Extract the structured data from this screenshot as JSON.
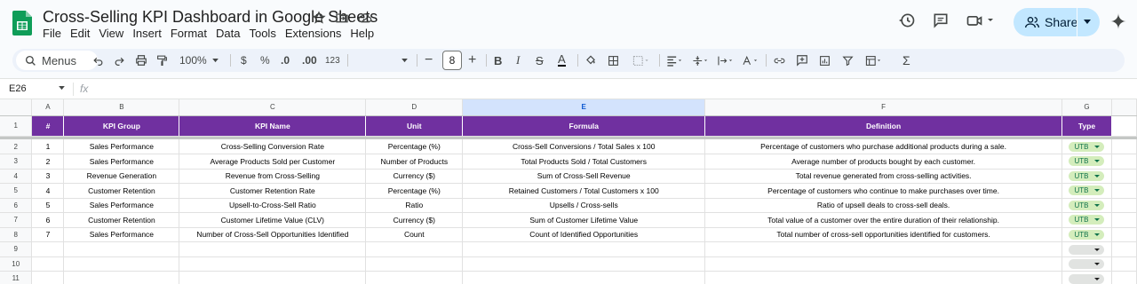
{
  "app": {
    "title": "Cross-Selling KPI Dashboard in Google Sheets",
    "share_label": "Share",
    "menu": [
      "File",
      "Edit",
      "View",
      "Insert",
      "Format",
      "Data",
      "Tools",
      "Extensions",
      "Help"
    ]
  },
  "toolbar": {
    "search_label": "Menus",
    "zoom": "100%",
    "currency": "$",
    "percent": "%",
    "dec_less": ".0",
    "dec_more": ".00",
    "number_format": "123",
    "font_size": "8"
  },
  "formula_bar": {
    "cell_ref": "E26",
    "fx": "fx",
    "value": ""
  },
  "grid": {
    "columns": [
      "A",
      "B",
      "C",
      "D",
      "E",
      "F",
      "G"
    ],
    "selected_column": "E",
    "headers": [
      "#",
      "KPI Group",
      "KPI Name",
      "Unit",
      "Formula",
      "Definition",
      "Type"
    ],
    "rows": [
      {
        "num": "1",
        "group": "Sales Performance",
        "name": "Cross-Selling Conversion Rate",
        "unit": "Percentage (%)",
        "formula": "Cross-Sell Conversions / Total Sales x 100",
        "definition": "Percentage of customers who purchase additional products during a sale.",
        "type": "UTB"
      },
      {
        "num": "2",
        "group": "Sales Performance",
        "name": "Average Products Sold per Customer",
        "unit": "Number of Products",
        "formula": "Total Products Sold / Total Customers",
        "definition": "Average number of products bought by each customer.",
        "type": "UTB"
      },
      {
        "num": "3",
        "group": "Revenue Generation",
        "name": "Revenue from Cross-Selling",
        "unit": "Currency ($)",
        "formula": "Sum of Cross-Sell Revenue",
        "definition": "Total revenue generated from cross-selling activities.",
        "type": "UTB"
      },
      {
        "num": "4",
        "group": "Customer Retention",
        "name": "Customer Retention Rate",
        "unit": "Percentage (%)",
        "formula": "Retained Customers / Total Customers x 100",
        "definition": "Percentage of customers who continue to make purchases over time.",
        "type": "UTB"
      },
      {
        "num": "5",
        "group": "Sales Performance",
        "name": "Upsell-to-Cross-Sell Ratio",
        "unit": "Ratio",
        "formula": "Upsells / Cross-sells",
        "definition": "Ratio of upsell deals to cross-sell deals.",
        "type": "UTB"
      },
      {
        "num": "6",
        "group": "Customer Retention",
        "name": "Customer Lifetime Value (CLV)",
        "unit": "Currency ($)",
        "formula": "Sum of Customer Lifetime Value",
        "definition": "Total value of a customer over the entire duration of their relationship.",
        "type": "UTB"
      },
      {
        "num": "7",
        "group": "Sales Performance",
        "name": "Number of Cross-Sell Opportunities Identified",
        "unit": "Count",
        "formula": "Count of Identified Opportunities",
        "definition": "Total number of cross-sell opportunities identified for customers.",
        "type": "UTB"
      }
    ],
    "row_numbers": [
      "1",
      "2",
      "3",
      "4",
      "5",
      "6",
      "7",
      "8",
      "9",
      "10",
      "11"
    ]
  },
  "colors": {
    "header_bg": "#7030a0",
    "chip_bg": "#d4edbc",
    "chip_text": "#11734b",
    "share_bg": "#c2e7ff"
  }
}
